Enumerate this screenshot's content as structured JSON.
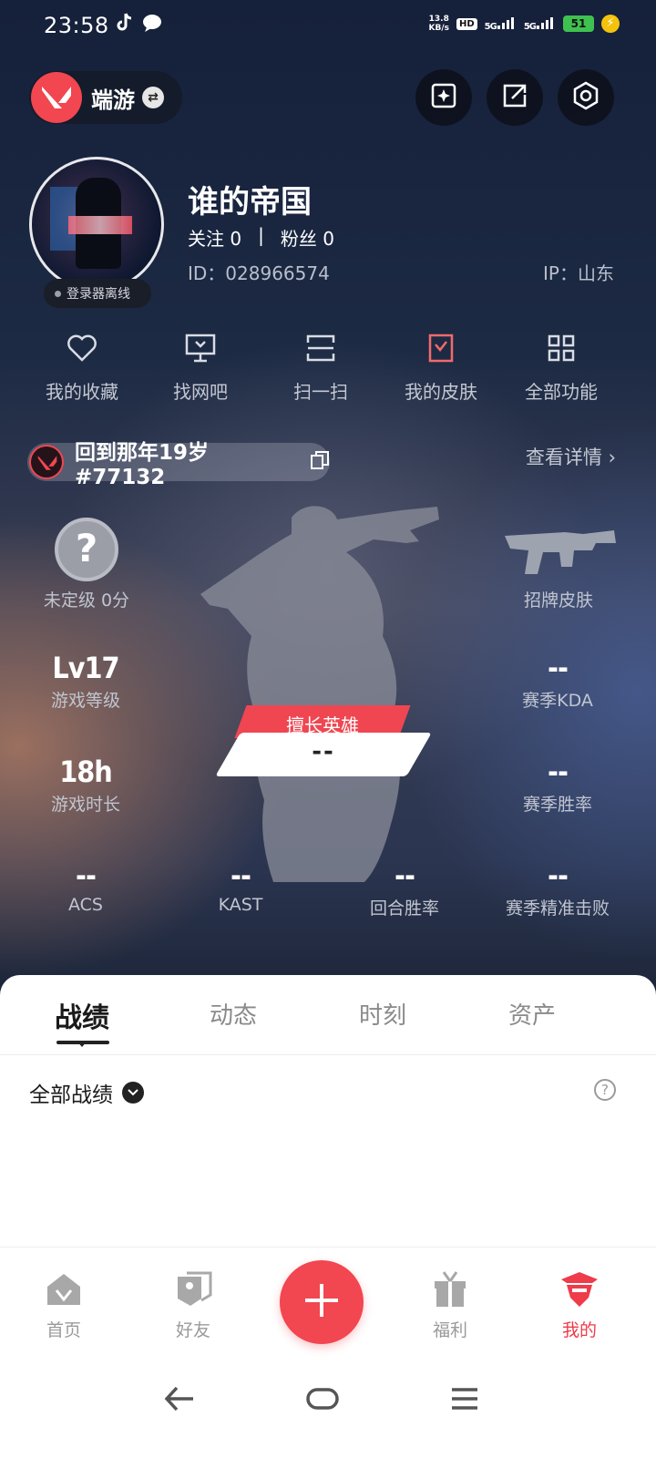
{
  "status_bar": {
    "time": "23:58",
    "speed_value": "13.8",
    "speed_unit": "KB/s",
    "hd": "HD",
    "sim1": "5G",
    "sim2": "5G",
    "battery": "51",
    "left_icons": [
      "tiktok-icon",
      "chat-bubble-icon"
    ]
  },
  "header": {
    "brand_name": "端游",
    "buttons": [
      "star-card-icon",
      "share-icon",
      "settings-icon"
    ]
  },
  "profile": {
    "username": "谁的帝国",
    "following_label": "关注 0",
    "separator": "|",
    "followers_label": "粉丝 0",
    "id_text": "ID：028966574",
    "ip_text": "IP：山东",
    "offline_status": "登录器离线"
  },
  "functions": [
    {
      "label": "我的收藏",
      "icon": "heart-icon"
    },
    {
      "label": "找网吧",
      "icon": "monitor-icon"
    },
    {
      "label": "扫一扫",
      "icon": "scan-icon"
    },
    {
      "label": "我的皮肤",
      "icon": "skin-icon"
    },
    {
      "label": "全部功能",
      "icon": "grid-icon"
    }
  ],
  "account": {
    "riot_id": "回到那年19岁#77132",
    "details_link": "查看详情 ›"
  },
  "stats": {
    "rank": {
      "symbol": "?",
      "label": "未定级 0分"
    },
    "signature_skin_label": "招牌皮肤",
    "level": {
      "value": "Lv17",
      "label": "游戏等级"
    },
    "playtime": {
      "value": "18h",
      "label": "游戏时长"
    },
    "season_kda": {
      "value": "--",
      "label": "赛季KDA"
    },
    "season_winrate": {
      "value": "--",
      "label": "赛季胜率"
    },
    "best_hero": {
      "tag": "擅长英雄",
      "value": "--"
    },
    "acs": {
      "value": "--",
      "label": "ACS"
    },
    "kast": {
      "value": "--",
      "label": "KAST"
    },
    "round_winrate": {
      "value": "--",
      "label": "回合胜率"
    },
    "headshot": {
      "value": "--",
      "label": "赛季精准击败"
    }
  },
  "tabs": [
    {
      "label": "战绩",
      "active": true
    },
    {
      "label": "动态",
      "active": false
    },
    {
      "label": "时刻",
      "active": false
    },
    {
      "label": "资产",
      "active": false
    }
  ],
  "filter": {
    "label": "全部战绩"
  },
  "bottom_nav": [
    {
      "label": "首页",
      "icon": "home-icon"
    },
    {
      "label": "好友",
      "icon": "friends-icon"
    },
    {
      "label": "",
      "icon": "plus-icon"
    },
    {
      "label": "福利",
      "icon": "gift-icon"
    },
    {
      "label": "我的",
      "icon": "profile-agent-icon",
      "active": true
    }
  ],
  "colors": {
    "accent": "#f24650",
    "active_nav": "#ef3b4a"
  }
}
